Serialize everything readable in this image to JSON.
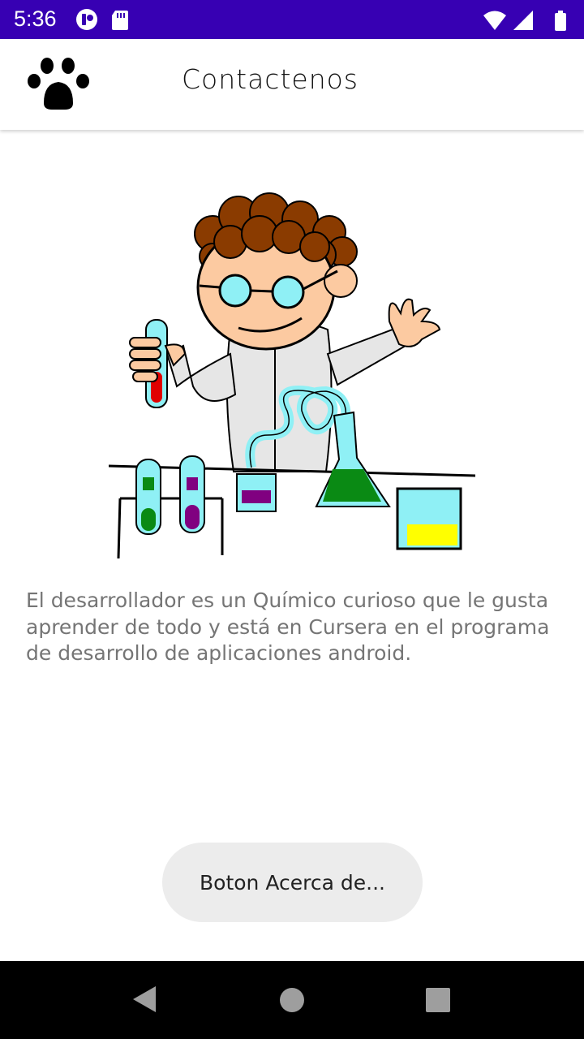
{
  "status_bar": {
    "time": "5:36",
    "left_icons": [
      "app-notification-icon",
      "sd-card-icon"
    ],
    "right_icons": [
      "wifi-icon",
      "cell-signal-icon",
      "battery-icon"
    ],
    "color": "#3700b3"
  },
  "appbar": {
    "logo_icon": "paw-icon",
    "title": "Contactenos"
  },
  "content": {
    "illustration": "chemist-illustration",
    "description": "El desarrollador es un Químico curioso que le gusta aprender de todo y está en Cursera en el programa de desarrollo de aplicaciones android."
  },
  "toast": {
    "text": "Boton Acerca de..."
  },
  "navbar": {
    "buttons": [
      "back-icon",
      "home-icon",
      "recents-icon"
    ]
  }
}
